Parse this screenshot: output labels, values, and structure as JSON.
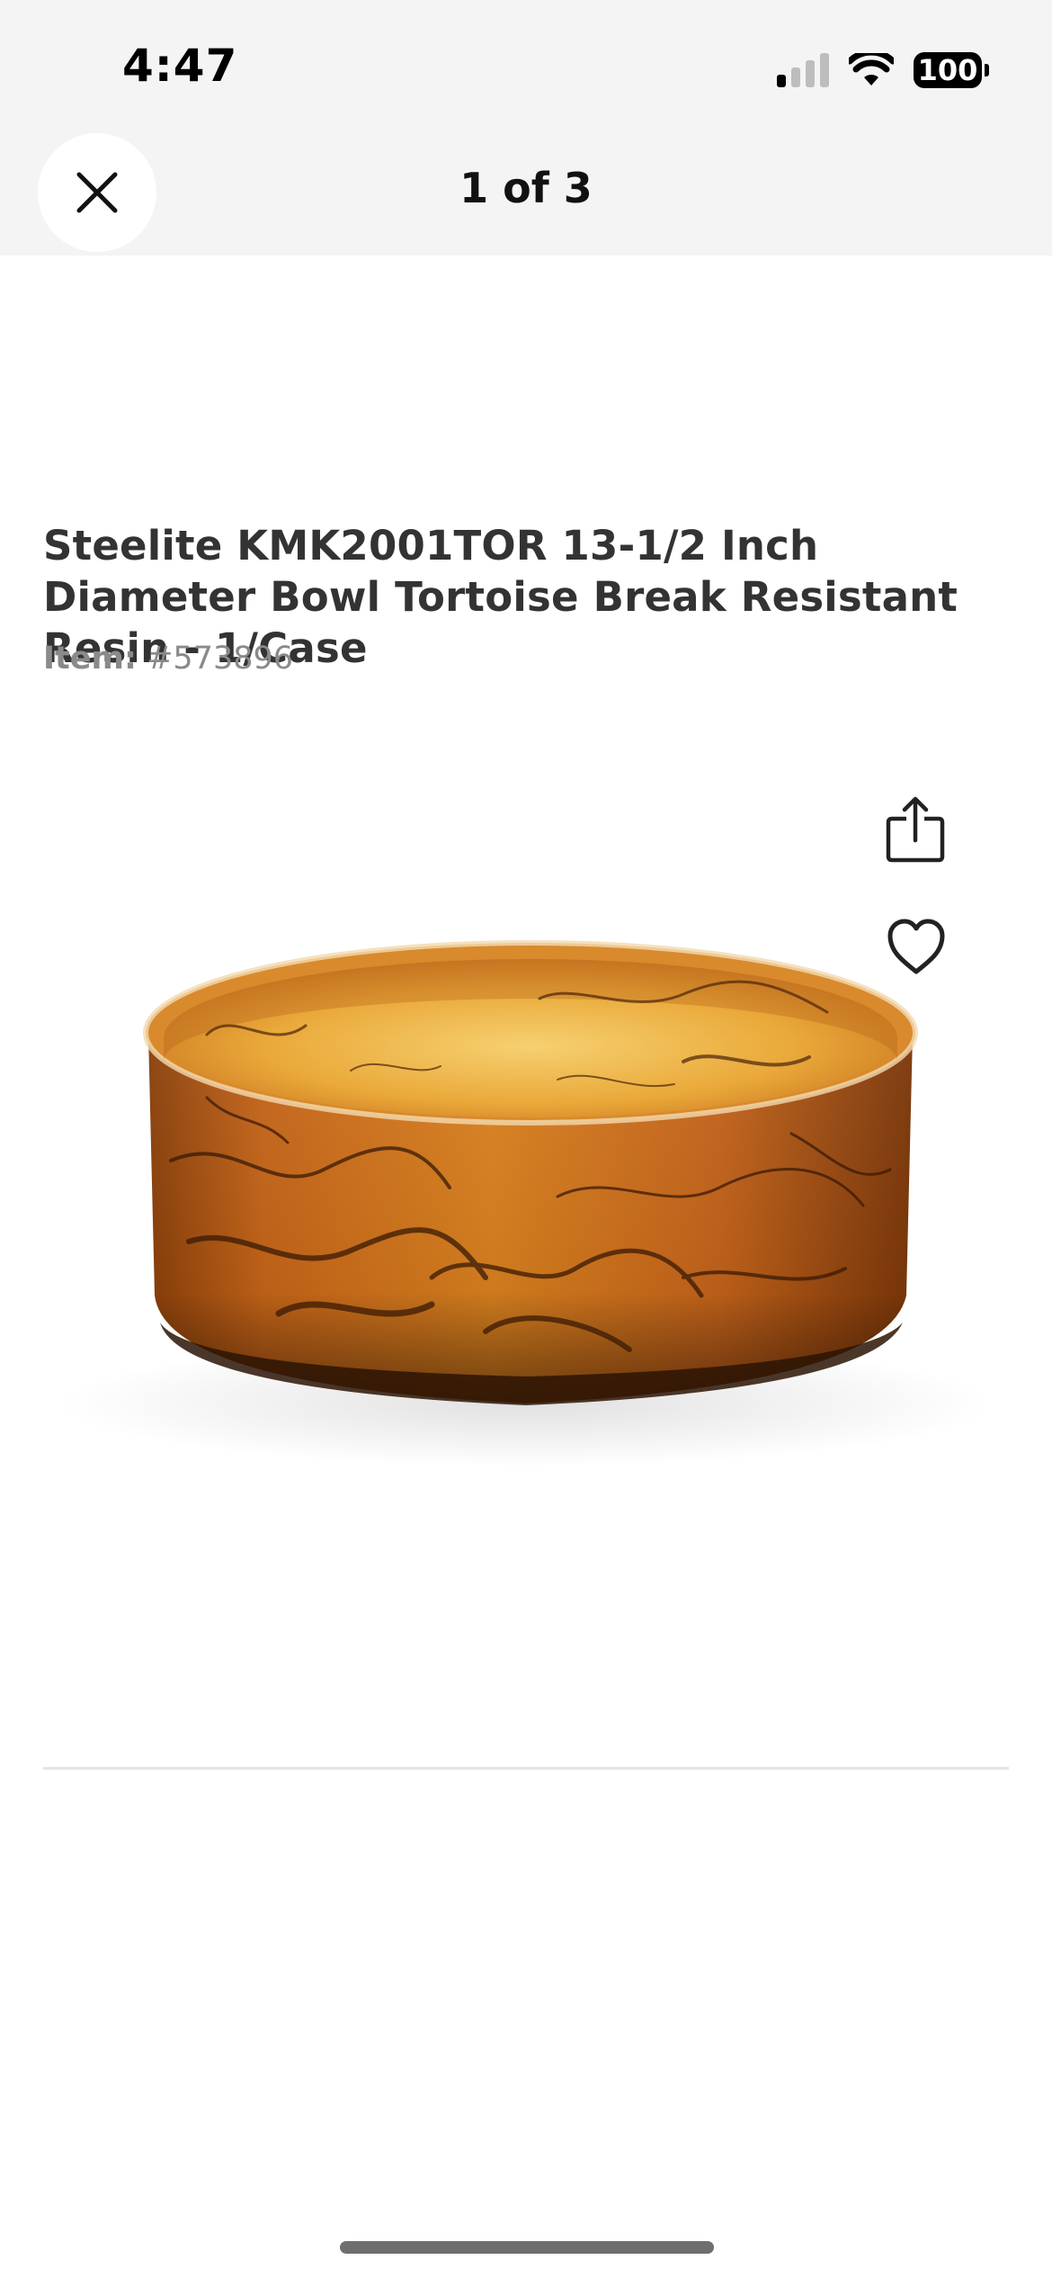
{
  "status_bar": {
    "time": "4:47",
    "battery": "100",
    "signal_bars_active": 1,
    "signal_bars_total": 4
  },
  "nav": {
    "title": "1 of 3",
    "close_icon": "close-icon"
  },
  "product": {
    "title": "Steelite KMK2001TOR 13-1/2 Inch Diameter Bowl Tortoise Break Resistant Resin - 1/Case",
    "item_label": "Item:",
    "item_number": "#573896",
    "image_icon": "tortoise-resin-bowl",
    "share_icon": "share-icon",
    "favorite_icon": "heart-icon"
  },
  "colors": {
    "top_bar_bg": "#f4f4f4",
    "title_text": "#333333",
    "muted_text": "#8a8a8a",
    "bowl_amber": "#c56a12",
    "bowl_dark": "#3a1c06"
  }
}
